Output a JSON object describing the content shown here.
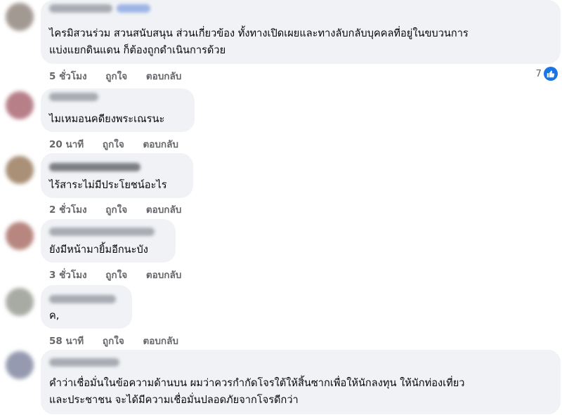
{
  "comments": [
    {
      "text_lines": [
        "ไครมิสวนร่วม สวนสนับสนุน ส่วนเกี่ยวข้อง ทั้งทางเปิดเผยและทางลับกลับบุคคลที่อยู่ในขบวนการ",
        "แบ่งแยกดินแดน ก็ต้องถูกดำเนินการด้วย"
      ],
      "time": "5 ชั่วโมง",
      "like": "ถูกใจ",
      "reply": "ตอบกลับ",
      "reaction_count": "7"
    },
    {
      "text_lines": [
        "ไมเหมอนคดียงพระเณรนะ"
      ],
      "time": "20 นาที",
      "like": "ถูกใจ",
      "reply": "ตอบกลับ"
    },
    {
      "text_lines": [
        "ไร้สาระไม่มีประโยชน์อะไร"
      ],
      "time": "2 ชั่วโมง",
      "like": "ถูกใจ",
      "reply": "ตอบกลับ"
    },
    {
      "text_lines": [
        "ยังมีหน้ามายิ้มอีกนะบัง"
      ],
      "time": "3 ชั่วโมง",
      "like": "ถูกใจ",
      "reply": "ตอบกลับ"
    },
    {
      "text_lines": [
        "ค,"
      ],
      "time": "58 นาที",
      "like": "ถูกใจ",
      "reply": "ตอบกลับ"
    },
    {
      "text_lines": [
        "คำว่าเชื่อมั่นในข้อความด้านบน ผมว่าควรกำกัดโจรใต้ให้สิ้นซากเพื่อให้นักลงทุน ให้นักท่องเที่ยว",
        "และประชาชน จะได้มีความเชื่อมั่นปลอดภัยจากโจรดีกว่า"
      ]
    }
  ],
  "colors": {
    "bubble": "#f0f2f5",
    "meta_text": "#65676b",
    "like_blue": "#1b74e4"
  },
  "icons": {
    "reaction": "like-thumb-icon"
  }
}
